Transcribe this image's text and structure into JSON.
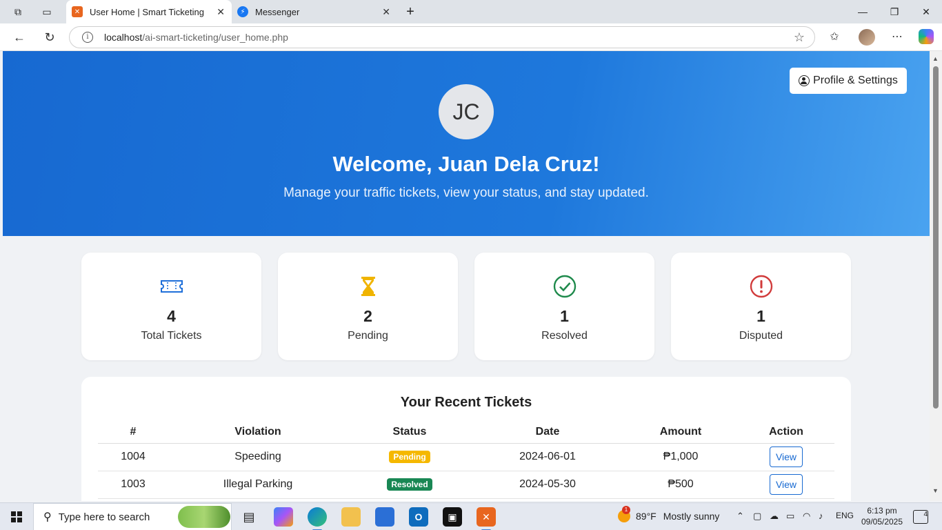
{
  "browser": {
    "tabs": [
      {
        "title": "User Home | Smart Ticketing",
        "active": true
      },
      {
        "title": "Messenger",
        "active": false
      }
    ],
    "url_host": "localhost",
    "url_path": "/ai-smart-ticketing/user_home.php"
  },
  "header": {
    "profile_button": "Profile & Settings",
    "avatar_initials": "JC",
    "welcome": "Welcome, Juan Dela Cruz!",
    "subtitle": "Manage your traffic tickets, view your status, and stay updated."
  },
  "stats": [
    {
      "icon": "ticket-icon",
      "value": "4",
      "label": "Total Tickets",
      "color": "#1e6fd9"
    },
    {
      "icon": "hourglass-icon",
      "value": "2",
      "label": "Pending",
      "color": "#f0b400"
    },
    {
      "icon": "check-circle-icon",
      "value": "1",
      "label": "Resolved",
      "color": "#1f8a4c"
    },
    {
      "icon": "exclamation-circle-icon",
      "value": "1",
      "label": "Disputed",
      "color": "#d13b3b"
    }
  ],
  "tickets": {
    "title": "Your Recent Tickets",
    "columns": [
      "#",
      "Violation",
      "Status",
      "Date",
      "Amount",
      "Action"
    ],
    "rows": [
      {
        "id": "1004",
        "violation": "Speeding",
        "status": "Pending",
        "status_color": "#f5b800",
        "date": "2024-06-01",
        "amount": "₱1,000",
        "action": "View"
      },
      {
        "id": "1003",
        "violation": "Illegal Parking",
        "status": "Resolved",
        "status_color": "#198754",
        "date": "2024-05-30",
        "amount": "₱500",
        "action": "View"
      }
    ]
  },
  "taskbar": {
    "search_placeholder": "Type here to search",
    "weather_temp": "89°F",
    "weather_text": "Mostly sunny",
    "weather_badge": "1",
    "language": "ENG",
    "time": "6:13 pm",
    "date": "09/05/2025",
    "notifications": "4"
  },
  "colors": {
    "hero_start": "#1769d1",
    "hero_end": "#4aa3f0",
    "accent": "#1769d1"
  }
}
